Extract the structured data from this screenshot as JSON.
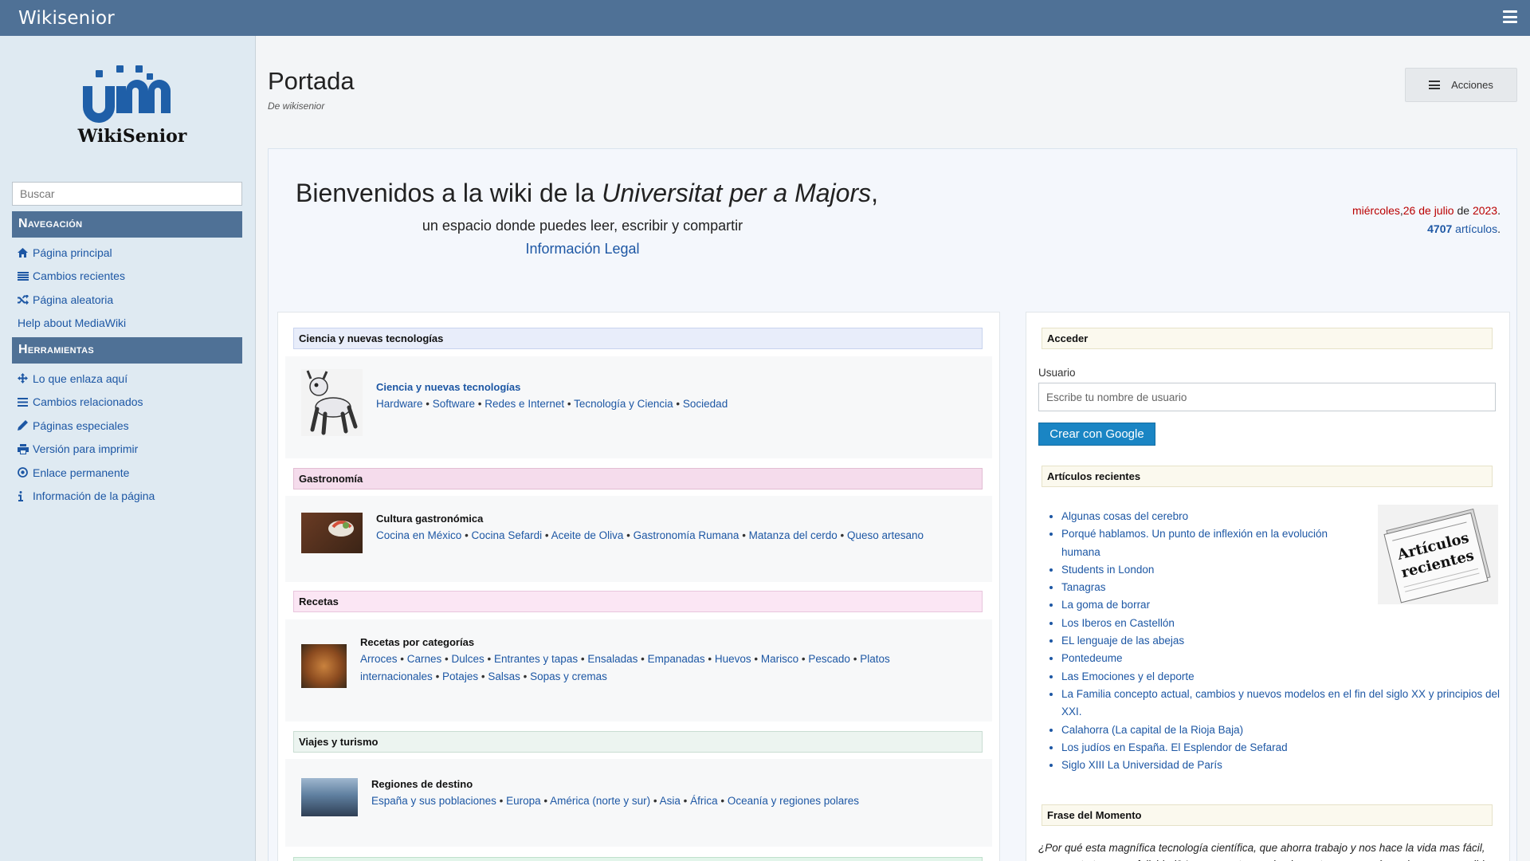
{
  "app": {
    "title": "Wikisenior"
  },
  "logo": {
    "text": "WikiSenior"
  },
  "search": {
    "placeholder": "Buscar"
  },
  "navigation": {
    "title": "Navegación",
    "items": [
      {
        "icon": "home-icon",
        "label": "Página principal"
      },
      {
        "icon": "list-icon",
        "label": "Cambios recientes"
      },
      {
        "icon": "shuffle-icon",
        "label": "Página aleatoria"
      },
      {
        "icon": "",
        "label": "Help about MediaWiki"
      }
    ]
  },
  "tools": {
    "title": "Herramientas",
    "items": [
      {
        "icon": "move-icon",
        "label": "Lo que enlaza aquí"
      },
      {
        "icon": "bars-icon",
        "label": "Cambios relacionados"
      },
      {
        "icon": "pencil-icon",
        "label": "Páginas especiales"
      },
      {
        "icon": "print-icon",
        "label": "Versión para imprimir"
      },
      {
        "icon": "target-icon",
        "label": "Enlace permanente"
      },
      {
        "icon": "info-icon",
        "label": "Información de la página"
      }
    ]
  },
  "page": {
    "title": "Portada",
    "subtitle": "De wikisenior",
    "actions_label": "Acciones"
  },
  "welcome": {
    "prefix": "Bienvenidos a la wiki de la ",
    "italic": "Universitat per a Majors",
    "suffix": ",",
    "tagline": "un espacio donde puedes leer, escribir y compartir",
    "legal": "Información Legal"
  },
  "datebox": {
    "weekday": "miércoles",
    "comma": ",",
    "day_month": "26 de julio",
    "de": " de ",
    "year": "2023",
    "period": ".",
    "count": "4707",
    "articles": " artículos",
    "period2": "."
  },
  "sections": [
    {
      "header": "Ciencia y nuevas tecnologías",
      "header_bg": "#e8edfa",
      "header_border": "#c8d3ee",
      "title": "Ciencia y nuevas tecnologías",
      "title_is_link": true,
      "links": [
        "Hardware",
        "Software",
        "Redes e Internet",
        "Tecnología y Ciencia",
        "Sociedad"
      ]
    },
    {
      "header": "Gastronomía",
      "header_bg": "#f5dcec",
      "header_border": "#e2bdd3",
      "title": "Cultura gastronómica",
      "title_is_link": false,
      "links": [
        "Cocina en México",
        "Cocina Sefardi",
        "Aceite de Oliva",
        "Gastronomía Rumana",
        "Matanza del cerdo",
        "Queso artesano"
      ]
    },
    {
      "header": "Recetas",
      "header_bg": "#fbe6f4",
      "header_border": "#e8c6dd",
      "title": "Recetas por categorías",
      "title_is_link": false,
      "links": [
        "Arroces",
        "Carnes",
        "Dulces",
        "Entrantes y tapas",
        "Ensaladas",
        "Empanadas",
        "Huevos",
        "Marisco",
        "Pescado",
        "Platos internacionales",
        "Potajes",
        "Salsas",
        "Sopas y cremas"
      ]
    },
    {
      "header": "Viajes y turismo",
      "header_bg": "#ecf4f0",
      "header_border": "#c9ddd2",
      "title": "Regiones de destino",
      "title_is_link": false,
      "links": [
        "España y sus poblaciones",
        "Europa",
        "América (norte y sur)",
        "Asia",
        "África",
        "Oceanía y regiones polares"
      ]
    }
  ],
  "login": {
    "header": "Acceder",
    "user_label": "Usuario",
    "user_placeholder": "Escribe tu nombre de usuario",
    "google_button": "Crear con Google"
  },
  "recent": {
    "header": "Artículos recientes",
    "image_caption": "Artículos recientes",
    "items": [
      "Algunas cosas del cerebro",
      "Porqué hablamos. Un punto de inflexión en la evolución humana",
      "Students in London",
      "Tanagras",
      "La goma de borrar",
      "Los Iberos en Castellón",
      "EL lenguaje de las abejas",
      "Pontedeume",
      "Las Emociones y el deporte",
      "La Familia concepto actual, cambios y nuevos modelos en el fin del siglo XX y principios del XXI.",
      "Calahorra (La capital de la Rioja Baja)",
      "Los judíos en España. El Esplendor de Sefarad",
      "Siglo XIII La Universidad de París"
    ]
  },
  "quote": {
    "header": "Frase del Momento",
    "text": "¿Por qué esta magnífica tecnología científica, que ahorra trabajo y nos hace la vida mas fácil, nos aporta tan poca felicidad? La respuesta es, simplemente: porque aún no hemos aprendido"
  },
  "colors": {
    "topbar": "#4f7196",
    "link": "#1d57a4",
    "date_red": "#ba0000",
    "google_button": "#1a85c4"
  }
}
